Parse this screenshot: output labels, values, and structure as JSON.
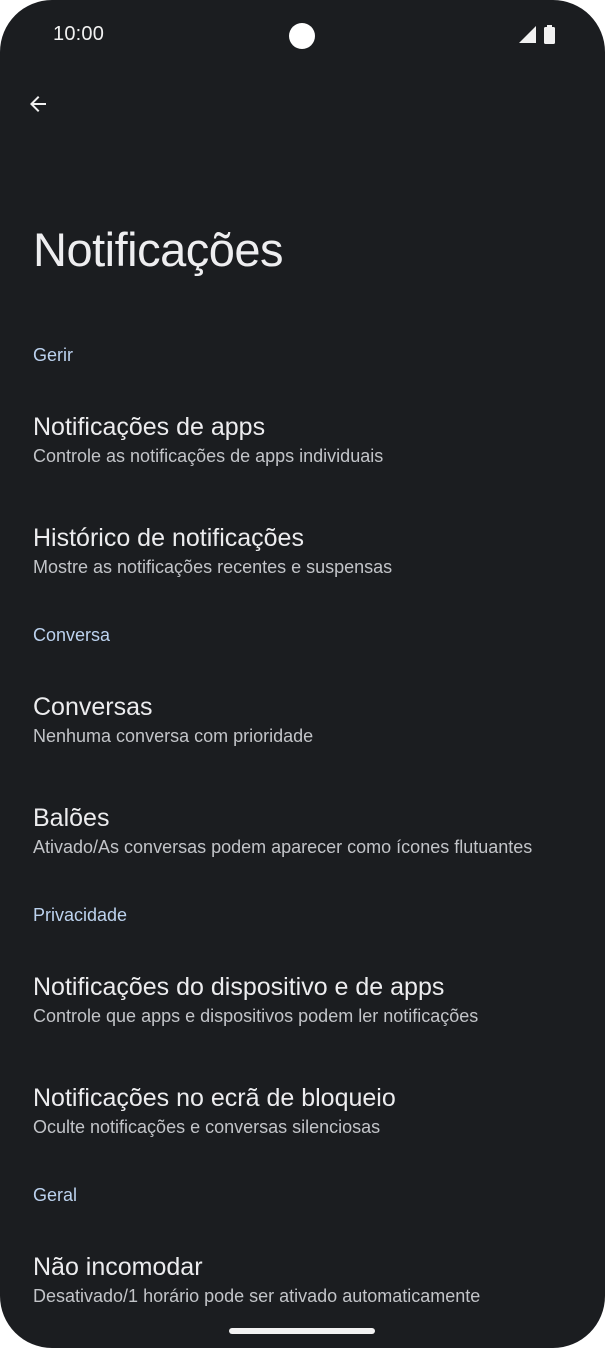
{
  "status_bar": {
    "time": "10:00"
  },
  "header": {
    "title": "Notificações"
  },
  "sections": [
    {
      "label": "Gerir",
      "items": [
        {
          "title": "Notificações de apps",
          "subtitle": "Controle as notificações de apps individuais"
        },
        {
          "title": "Histórico de notificações",
          "subtitle": "Mostre as notificações recentes e suspensas"
        }
      ]
    },
    {
      "label": "Conversa",
      "items": [
        {
          "title": "Conversas",
          "subtitle": "Nenhuma conversa com prioridade"
        },
        {
          "title": "Balões",
          "subtitle": "Ativado/As conversas podem aparecer como ícones flutuantes"
        }
      ]
    },
    {
      "label": "Privacidade",
      "items": [
        {
          "title": "Notificações do dispositivo e de apps",
          "subtitle": "Controle que apps e dispositivos podem ler notificações"
        },
        {
          "title": "Notificações no ecrã de bloqueio",
          "subtitle": "Oculte notificações e conversas silenciosas"
        }
      ]
    },
    {
      "label": "Geral",
      "items": [
        {
          "title": "Não incomodar",
          "subtitle": "Desativado/1 horário pode ser ativado automaticamente"
        }
      ]
    }
  ],
  "colors": {
    "background": "#1b1d20",
    "section_header": "#bcd2ee",
    "title_text": "#ececee",
    "subtitle_text": "#c2c4c8"
  },
  "icons": {
    "back": "arrow-left-icon",
    "signal": "cellular-signal-icon",
    "battery": "battery-icon"
  }
}
